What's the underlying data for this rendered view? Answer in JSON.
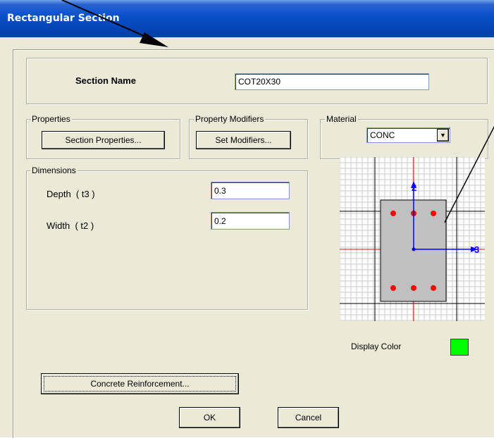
{
  "window": {
    "title": "Rectangular Section"
  },
  "section_name": {
    "label": "Section Name",
    "value": "COT20X30"
  },
  "properties": {
    "legend": "Properties",
    "button": "Section Properties..."
  },
  "property_modifiers": {
    "legend": "Property Modifiers",
    "button": "Set Modifiers..."
  },
  "material": {
    "legend": "Material",
    "selected": "CONC"
  },
  "dimensions": {
    "legend": "Dimensions",
    "depth_label": "Depth  ( t3 )",
    "depth_value": "0.3",
    "width_label": "Width  ( t2 )",
    "width_value": "0.2"
  },
  "preview": {
    "axis_2_label": "2",
    "axis_3_label": "3",
    "rebar_color": "#ff0000",
    "section_fill": "#c0c0c0",
    "axis_color": "#0000ff"
  },
  "display_color": {
    "label": "Display Color",
    "color": "#00ff00"
  },
  "buttons": {
    "reinforcement": "Concrete Reinforcement...",
    "ok": "OK",
    "cancel": "Cancel"
  }
}
